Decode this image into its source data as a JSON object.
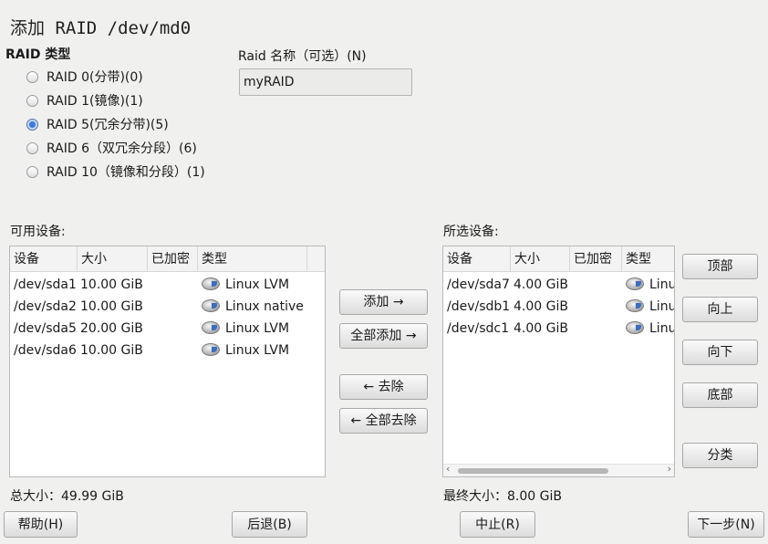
{
  "window": {
    "title": "添加 RAID /dev/md0"
  },
  "raid_type": {
    "label": "RAID 类型",
    "options": [
      {
        "label": "RAID 0(分带)(0)",
        "checked": false
      },
      {
        "label": "RAID 1(镜像)(1)",
        "checked": false
      },
      {
        "label": "RAID 5(冗余分带)(5)",
        "checked": true
      },
      {
        "label": "RAID 6（双冗余分段）(6)",
        "checked": false
      },
      {
        "label": "RAID 10（镜像和分段）(1)",
        "checked": false
      }
    ]
  },
  "raid_name": {
    "label": "Raid 名称（可选）(N)",
    "value": "myRAID"
  },
  "available": {
    "label": "可用设备:",
    "columns": [
      "设备",
      "大小",
      "已加密",
      "类型"
    ],
    "rows": [
      {
        "device": "/dev/sda1",
        "size": "10.00 GiB",
        "encrypted": "",
        "type": "Linux LVM"
      },
      {
        "device": "/dev/sda2",
        "size": "10.00 GiB",
        "encrypted": "",
        "type": "Linux native"
      },
      {
        "device": "/dev/sda5",
        "size": "20.00 GiB",
        "encrypted": "",
        "type": "Linux LVM"
      },
      {
        "device": "/dev/sda6",
        "size": "10.00 GiB",
        "encrypted": "",
        "type": "Linux LVM"
      }
    ],
    "total": "总大小：49.99 GiB"
  },
  "selected": {
    "label": "所选设备:",
    "columns": [
      "设备",
      "大小",
      "已加密",
      "类型"
    ],
    "rows": [
      {
        "device": "/dev/sda7",
        "size": "4.00 GiB",
        "encrypted": "",
        "type": "Linux"
      },
      {
        "device": "/dev/sdb1",
        "size": "4.00 GiB",
        "encrypted": "",
        "type": "Linux"
      },
      {
        "device": "/dev/sdc1",
        "size": "4.00 GiB",
        "encrypted": "",
        "type": "Linux"
      }
    ],
    "total": "最终大小：8.00 GiB"
  },
  "transfer_buttons": {
    "add": "添加 →",
    "add_all": "全部添加 →",
    "remove": "← 去除",
    "remove_all": "← 全部去除"
  },
  "order_buttons": {
    "top": "顶部",
    "up": "向上",
    "down": "向下",
    "bottom": "底部",
    "sort": "分类"
  },
  "footer": {
    "help": "帮助(H)",
    "back": "后退(B)",
    "abort": "中止(R)",
    "next": "下一步(N)"
  },
  "scroll_arrows": {
    "left": "‹",
    "right": "›"
  }
}
